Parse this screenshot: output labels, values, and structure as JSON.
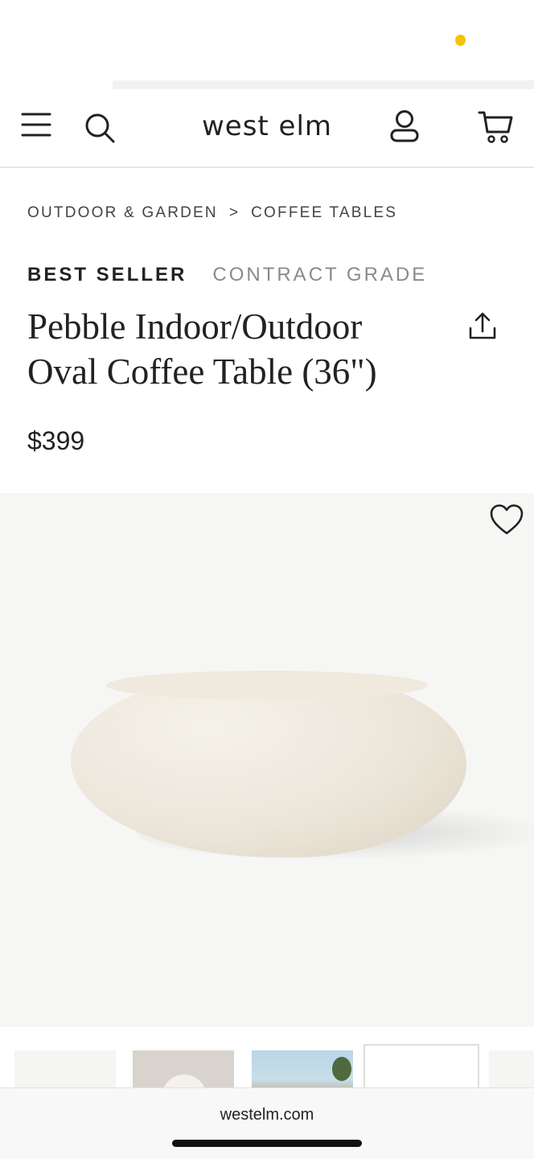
{
  "header": {
    "logo": "west elm",
    "icons": [
      "menu-icon",
      "search-icon",
      "account-icon",
      "cart-icon"
    ]
  },
  "breadcrumb": {
    "items": [
      "OUTDOOR & GARDEN",
      "COFFEE TABLES"
    ],
    "separator": ">"
  },
  "product": {
    "badges": [
      "BEST SELLER",
      "CONTRACT GRADE"
    ],
    "title_line1": "Pebble Indoor/Outdoor",
    "title_line2": "Oval Coffee Table (36\")",
    "price": "$399",
    "actions": [
      "share-icon",
      "wishlist-heart-icon"
    ]
  },
  "browser": {
    "url": "westelm.com"
  },
  "colors": {
    "status_dot": "#f5c400",
    "hero_bg": "#f6f6f5",
    "product_color": "#ece6da"
  }
}
